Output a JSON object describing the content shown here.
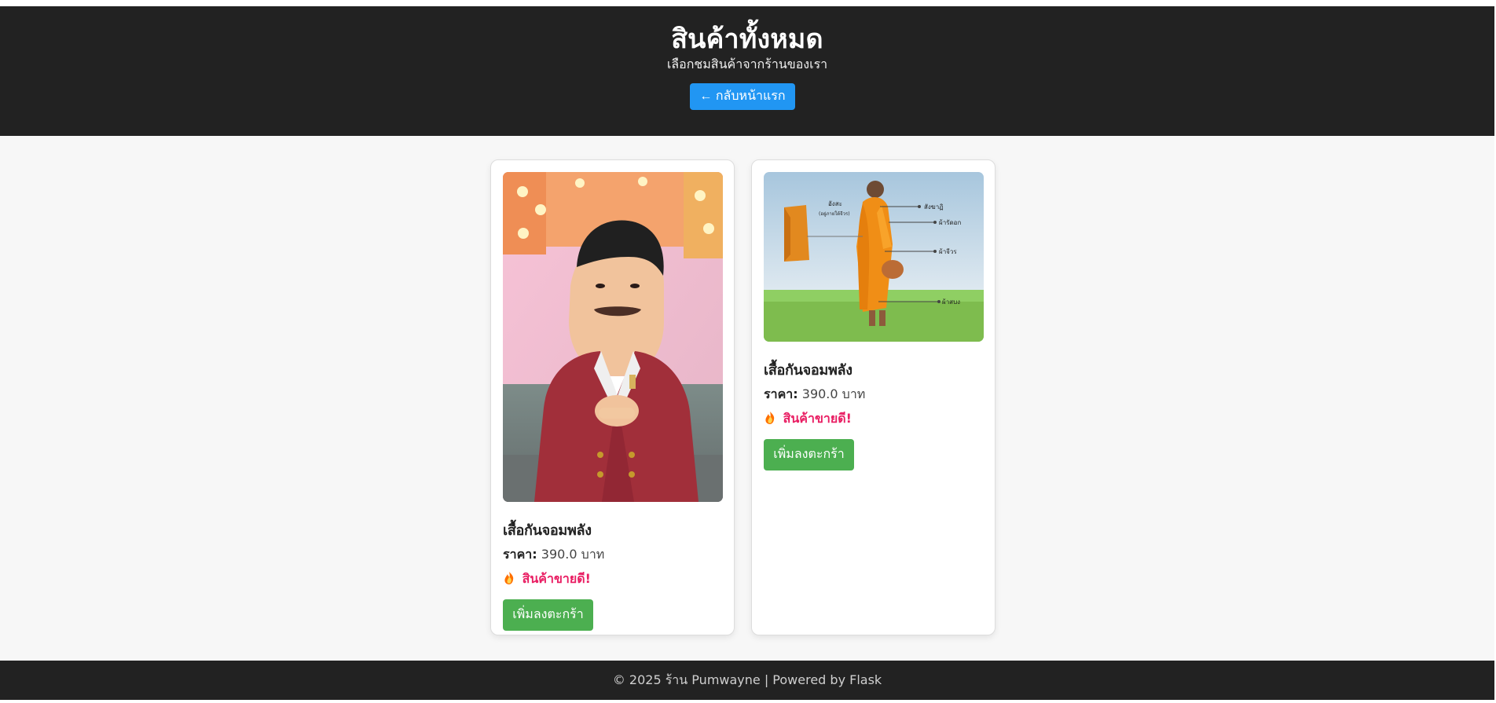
{
  "header": {
    "title": "สินค้าทั้งหมด",
    "subtitle": "เลือกชมสินค้าจากร้านของเรา",
    "back_button_label": "← กลับหน้าแรก"
  },
  "products": [
    {
      "name": "เสื้อกันจอมพลัง",
      "price_label": "ราคา:",
      "price_value": "390.0 บาท",
      "bestseller_text": "สินค้าขายดี!",
      "add_button_label": "เพิ่มลงตะกร้า",
      "image_icon": "man-in-red-suit-photo-icon"
    },
    {
      "name": "เสื้อกันจอมพลัง",
      "price_label": "ราคา:",
      "price_value": "390.0 บาท",
      "bestseller_text": "สินค้าขายดี!",
      "add_button_label": "เพิ่มลงตะกร้า",
      "image_icon": "monk-robe-diagram-icon",
      "image_labels": [
        "อังสะ",
        "(อยู่ภายใต้จีวร)",
        "สังฆาฏิ",
        "ผ้ารัดอก",
        "ผ้าจีวร",
        "ผ้าสบง"
      ]
    }
  ],
  "footer": {
    "text": "© 2025 ร้าน Pumwayne | Powered by Flask"
  },
  "colors": {
    "header_bg": "#222222",
    "page_bg": "#f7f7f7",
    "primary_button": "#2196f3",
    "add_button": "#4caf50",
    "bestseller": "#e91e63"
  }
}
